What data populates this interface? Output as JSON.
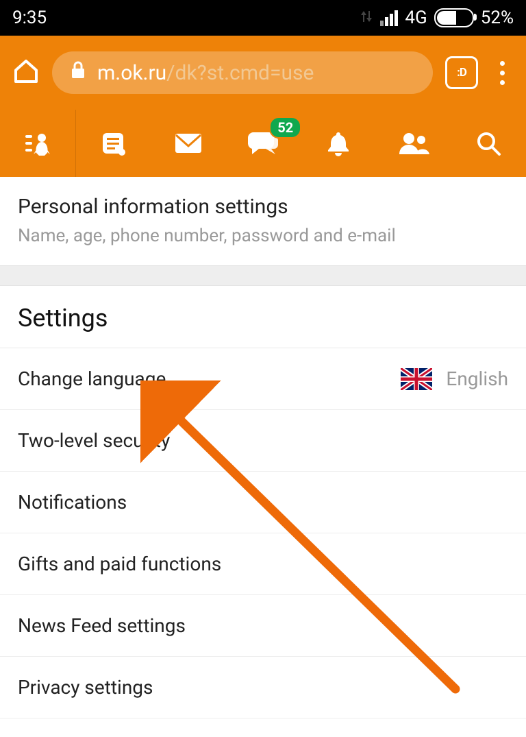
{
  "status_bar": {
    "time": "9:35",
    "network_type": "4G",
    "battery_percent": "52%"
  },
  "browser": {
    "url_host": "m.ok.ru",
    "url_path": "/dk?st.cmd=use",
    "tab_indicator": ":D"
  },
  "nav": {
    "messages_badge": "52"
  },
  "personal": {
    "title": "Personal information settings",
    "subtitle": "Name, age, phone number, password and e-mail"
  },
  "settings": {
    "heading": "Settings",
    "language_value": "English",
    "rows": {
      "0": "Change language",
      "1": "Two-level security",
      "2": "Notifications",
      "3": "Gifts and paid functions",
      "4": "News Feed settings",
      "5": "Privacy settings"
    }
  }
}
